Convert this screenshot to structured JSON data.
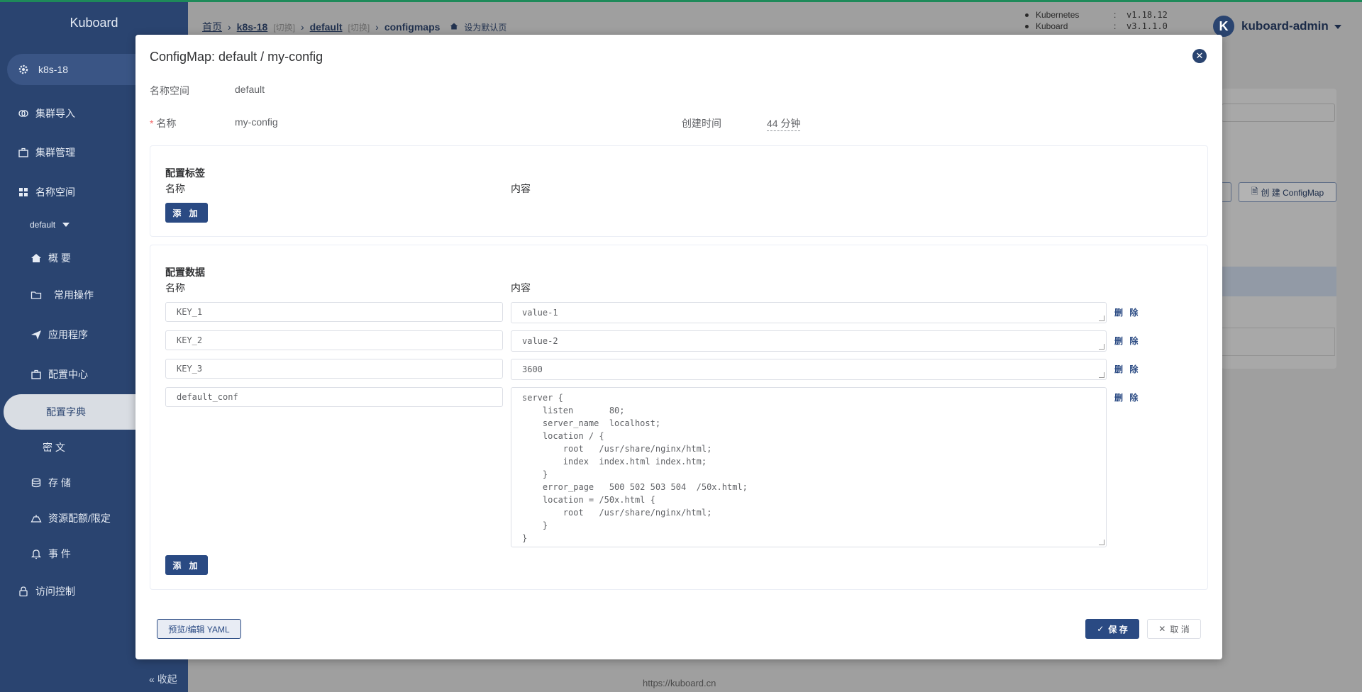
{
  "sidebar": {
    "logo": "Kuboard",
    "cluster": "k8s-18",
    "items": [
      {
        "label": "集群导入",
        "icon": "link-icon"
      },
      {
        "label": "集群管理",
        "icon": "briefcase-icon"
      },
      {
        "label": "名称空间",
        "icon": "grid-icon"
      },
      {
        "label": "default",
        "icon": "caret-down-icon"
      },
      {
        "label": "概 要",
        "icon": "home-icon"
      },
      {
        "label": "常用操作",
        "icon": "folder-icon"
      },
      {
        "label": "应用程序",
        "icon": "send-icon"
      },
      {
        "label": "配置中心",
        "icon": "briefcase-icon"
      },
      {
        "label": "配置字典",
        "icon": ""
      },
      {
        "label": "密 文",
        "icon": ""
      },
      {
        "label": "存 储",
        "icon": "database-icon"
      },
      {
        "label": "资源配额/限定",
        "icon": "gauge-icon"
      },
      {
        "label": "事 件",
        "icon": "bell-icon"
      },
      {
        "label": "访问控制",
        "icon": "lock-icon"
      }
    ],
    "collapse": "收起"
  },
  "header": {
    "breadcrumb": {
      "home": "首页",
      "cluster": "k8s-18",
      "switch1": "[切换]",
      "namespace": "default",
      "switch2": "[切换]",
      "resource": "configmaps",
      "set_default": "设为默认页"
    },
    "versions": [
      {
        "name": "Kubernetes",
        "value": "v1.18.12"
      },
      {
        "name": "Kuboard",
        "value": "v3.1.1.0"
      }
    ],
    "user": {
      "initial": "K",
      "name": "kuboard-admin"
    }
  },
  "background": {
    "create_button": "创 建 ConfigMap",
    "footer": "https://kuboard.cn"
  },
  "modal": {
    "title": "ConfigMap: default / my-config",
    "namespace_label": "名称空间",
    "namespace_value": "default",
    "name_label": "名称",
    "name_value": "my-config",
    "created_label": "创建时间",
    "created_value": "44 分钟",
    "labels_section": {
      "title": "配置标签",
      "col_name": "名称",
      "col_content": "内容",
      "add": "添 加"
    },
    "data_section": {
      "title": "配置数据",
      "col_name": "名称",
      "col_content": "内容",
      "delete": "删 除",
      "add": "添 加",
      "rows": [
        {
          "key": "KEY_1",
          "value": "value-1"
        },
        {
          "key": "KEY_2",
          "value": "value-2"
        },
        {
          "key": "KEY_3",
          "value": "3600"
        },
        {
          "key": "default_conf",
          "value": "server {\n    listen       80;\n    server_name  localhost;\n    location / {\n        root   /usr/share/nginx/html;\n        index  index.html index.htm;\n    }\n    error_page   500 502 503 504  /50x.html;\n    location = /50x.html {\n        root   /usr/share/nginx/html;\n    }\n}"
        }
      ]
    },
    "yaml_button": "预览/编辑 YAML",
    "save_button": "保 存",
    "cancel_button": "取 消"
  }
}
